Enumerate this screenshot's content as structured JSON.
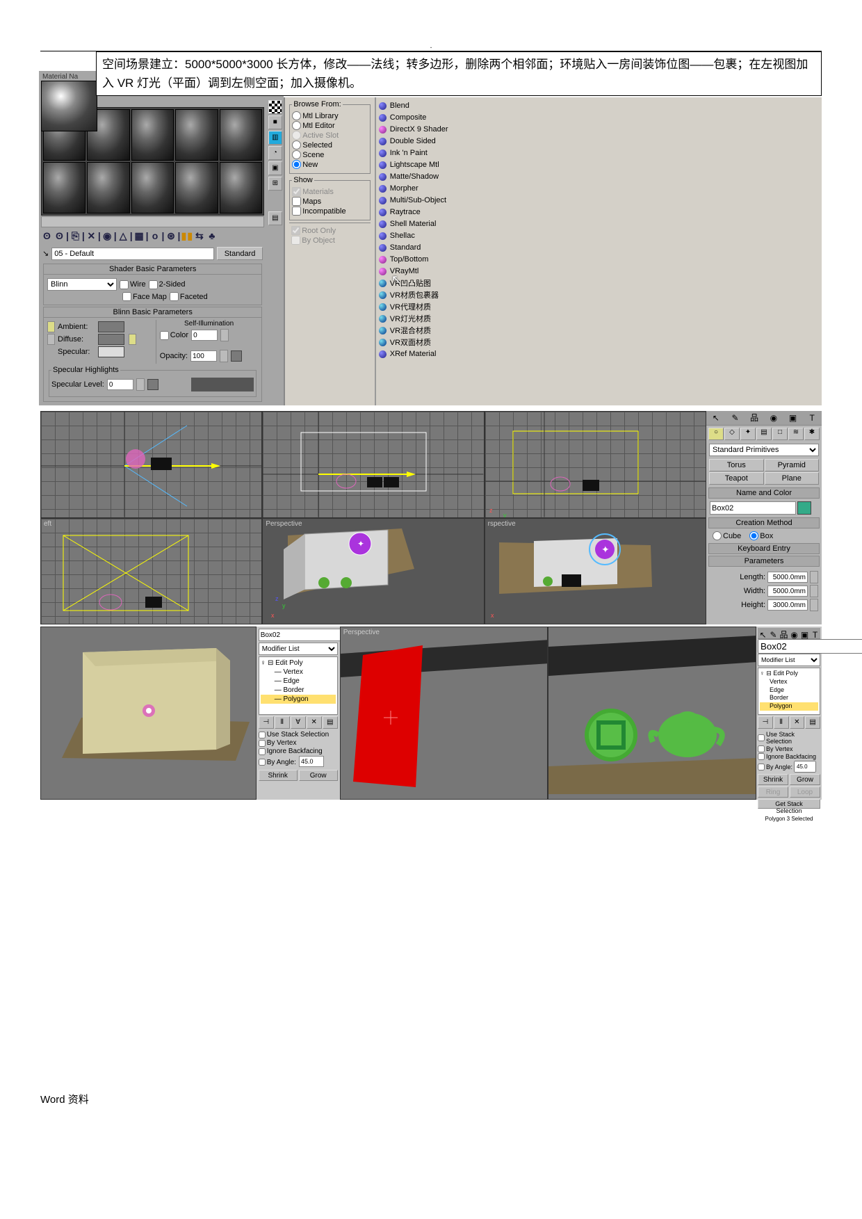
{
  "caption": "空间场景建立：5000*5000*3000 长方体，修改——法线；转多边形，删除两个相邻面；环境贴入一房间装饰位图——包裹；在左视图加入 VR 灯光（平面）调到左侧空面；加入摄像机。",
  "material": {
    "title": "Material  Na",
    "name": "05 - Default",
    "std": "Standard",
    "shader_title": "Shader Basic Parameters",
    "shader": "Blinn",
    "wire": "Wire",
    "sided": "2-Sided",
    "facemap": "Face Map",
    "faceted": "Faceted",
    "blinn_title": "Blinn Basic Parameters",
    "ambient": "Ambient:",
    "diffuse": "Diffuse:",
    "specular": "Specular:",
    "selfillum": "Self-Illumination",
    "color": "Color",
    "color_v": "0",
    "opacity": "Opacity:",
    "opacity_v": "100",
    "sh_title": "Specular Highlights",
    "sl": "Specular Level:",
    "sl_v": "0"
  },
  "browse": {
    "title": "Browse From:",
    "r1": "Mtl Library",
    "r2": "Mtl Editor",
    "r3": "Active Slot",
    "r4": "Selected",
    "r5": "Scene",
    "r6": "New",
    "show": "Show",
    "s1": "Materials",
    "s2": "Maps",
    "s3": "Incompatible",
    "s4": "Root Only",
    "s5": "By Object"
  },
  "mats": [
    "Blend",
    "Composite",
    "DirectX 9 Shader",
    "Double Sided",
    "Ink 'n Paint",
    "Lightscape Mtl",
    "Matte/Shadow",
    "Morpher",
    "Multi/Sub-Object",
    "Raytrace",
    "Shell Material",
    "Shellac",
    "Standard",
    "Top/Bottom",
    "VRayMtl",
    "VR凹凸贴图",
    "VR材质包裹器",
    "VR代理材质",
    "VR灯光材质",
    "VR混合材质",
    "VR双面材质",
    "XRef Material"
  ],
  "cmd": {
    "drop": "Standard Primitives",
    "torus": "Torus",
    "pyramid": "Pyramid",
    "teapot": "Teapot",
    "plane": "Plane",
    "nc": "Name and Color",
    "box": "Box02",
    "cm": "Creation Method",
    "cube": "Cube",
    "boxr": "Box",
    "ke": "Keyboard Entry",
    "params": "Parameters",
    "len": "Length:",
    "len_v": "5000.0mm",
    "wid": "Width:",
    "wid_v": "5000.0mm",
    "hei": "Height:",
    "hei_v": "3000.0mm"
  },
  "mod": {
    "obj": "Box02",
    "ml": "Modifier List",
    "ep": "Edit Poly",
    "v": "Vertex",
    "e": "Edge",
    "b": "Border",
    "p": "Polygon",
    "uss": "Use Stack Selection",
    "bv": "By Vertex",
    "ib": "Ignore Backfacing",
    "ba": "By Angle:",
    "ba_v": "45.0",
    "shrink": "Shrink",
    "grow": "Grow",
    "gss": "Get Stack Selection",
    "ps": "Polygon 3 Selected"
  },
  "labels": {
    "persp": "Perspective",
    "rspec": "rspective",
    "eft": "eft"
  },
  "footer": "Word 资料"
}
